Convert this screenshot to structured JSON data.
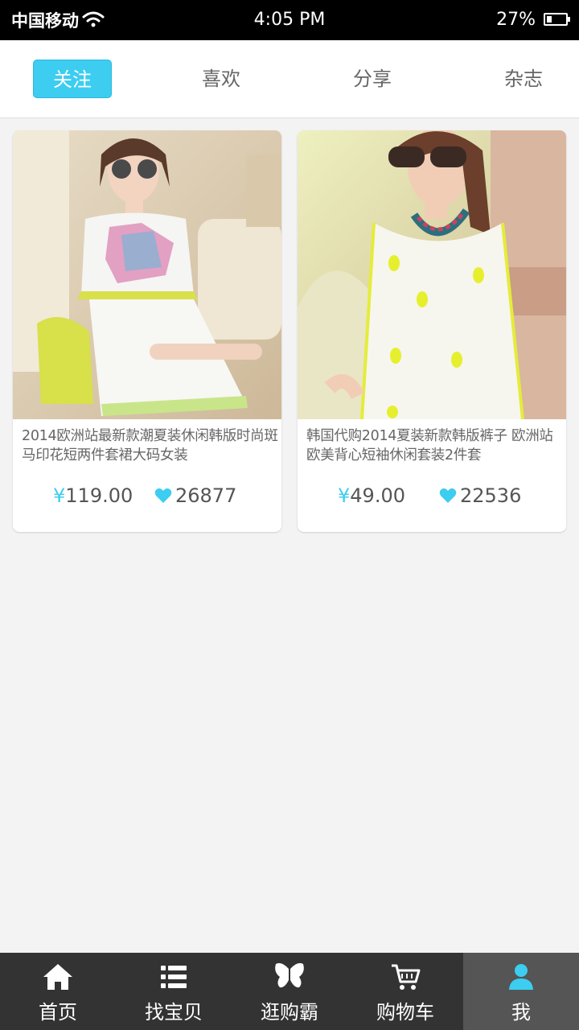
{
  "status_bar": {
    "carrier": "中国移动",
    "time": "4:05 PM",
    "battery": "27%",
    "battery_level": 0.27
  },
  "tabs": [
    {
      "label": "关注",
      "active": true
    },
    {
      "label": "喜欢",
      "active": false
    },
    {
      "label": "分享",
      "active": false
    },
    {
      "label": "杂志",
      "active": false
    }
  ],
  "products": [
    {
      "title": "2014欧洲站最新款潮夏装休闲韩版时尚斑马印花短两件套裙大码女装",
      "currency": "¥",
      "price": "119.00",
      "likes": "26877"
    },
    {
      "title": "韩国代购2014夏装新款韩版裤子 欧洲站欧美背心短袖休闲套装2件套",
      "currency": "¥",
      "price": "49.00",
      "likes": "22536"
    }
  ],
  "bottom_nav": [
    {
      "label": "首页",
      "icon": "home-icon",
      "active": false
    },
    {
      "label": "找宝贝",
      "icon": "list-icon",
      "active": false
    },
    {
      "label": "逛购霸",
      "icon": "butterfly-icon",
      "active": false
    },
    {
      "label": "购物车",
      "icon": "cart-icon",
      "active": false
    },
    {
      "label": "我",
      "icon": "user-icon",
      "active": true
    }
  ],
  "colors": {
    "accent": "#3ccdf0",
    "nav_bg": "#333333",
    "nav_active_bg": "#555555",
    "page_bg": "#f3f3f3"
  }
}
